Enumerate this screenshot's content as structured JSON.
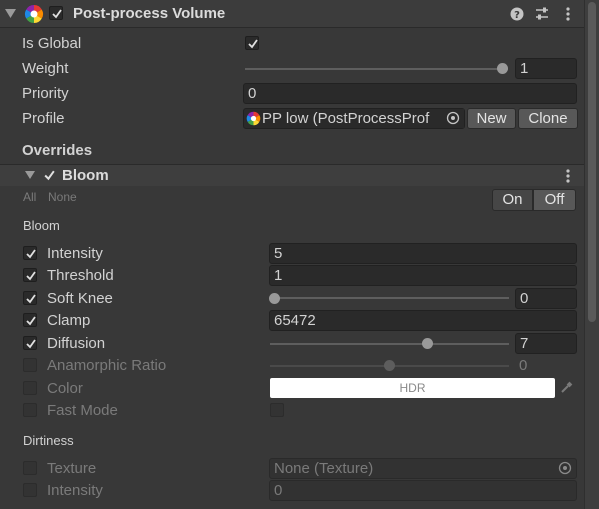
{
  "header": {
    "title": "Post-process Volume",
    "enabled": true
  },
  "volume": {
    "is_global_label": "Is Global",
    "is_global": true,
    "weight_label": "Weight",
    "weight_value": "1",
    "weight_fraction": 1.0,
    "priority_label": "Priority",
    "priority_value": "0",
    "profile_label": "Profile",
    "profile_value": "PP low (PostProcessProf",
    "new_label": "New",
    "clone_label": "Clone"
  },
  "overrides": {
    "title": "Overrides",
    "effect_title": "Bloom",
    "effect_enabled": true,
    "all_label": "All",
    "none_label": "None",
    "on_label": "On",
    "off_label": "Off",
    "active_toggle": "On"
  },
  "bloom": {
    "section_label": "Bloom",
    "rows": [
      {
        "label": "Intensity",
        "checked": true,
        "value": "5"
      },
      {
        "label": "Threshold",
        "checked": true,
        "value": "1"
      },
      {
        "label": "Soft Knee",
        "checked": true,
        "value": "0",
        "slider_fraction": 0.0
      },
      {
        "label": "Clamp",
        "checked": true,
        "value": "65472"
      },
      {
        "label": "Diffusion",
        "checked": true,
        "value": "7",
        "slider_fraction": 0.6
      },
      {
        "label": "Anamorphic Ratio",
        "checked": false,
        "value": "0",
        "slider_fraction": 0.5
      },
      {
        "label": "Color",
        "checked": false,
        "value": "HDR",
        "color": "#ffffff"
      },
      {
        "label": "Fast Mode",
        "checked": false
      }
    ]
  },
  "dirtiness": {
    "section_label": "Dirtiness",
    "texture_label": "Texture",
    "texture_value": "None (Texture)",
    "intensity_label": "Intensity",
    "intensity_value": "0"
  },
  "colors": {
    "background": "#383838",
    "field": "#2a2a2a",
    "text": "#d2d2d2",
    "disabled_text": "#7a7a7a"
  }
}
